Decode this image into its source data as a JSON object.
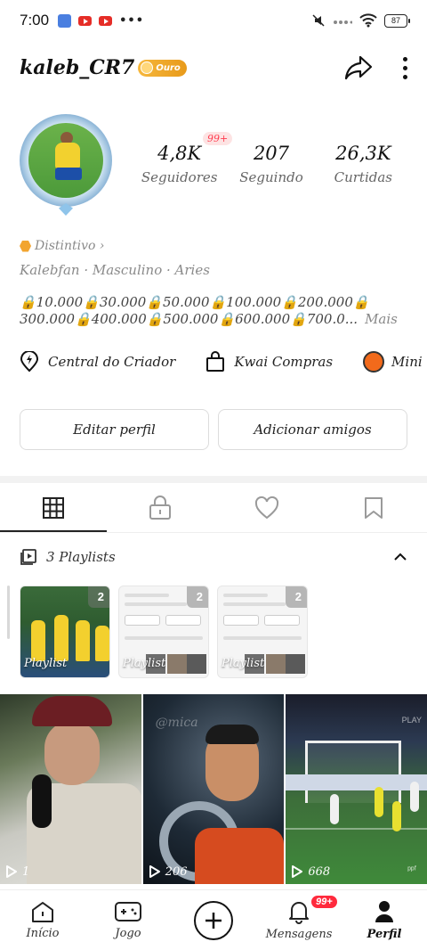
{
  "status_bar": {
    "time": "7:00",
    "notif_dots": "•••",
    "battery": "87"
  },
  "profile": {
    "username": "kaleb_CR7",
    "tier_badge": "Ouro",
    "stats": [
      {
        "value": "4,8K",
        "label": "Seguidores"
      },
      {
        "value": "207",
        "label": "Seguindo"
      },
      {
        "value": "26,3K",
        "label": "Curtidas"
      }
    ],
    "followers_notification": "99+",
    "distintivo": "Distintivo ›",
    "info_line": "Kalebfan · Masculino · Aries",
    "bio_line1": "🔒10.000🔒30.000🔒50.000🔒100.000🔒200.000🔒",
    "bio_line2": "300.000🔒400.000🔒500.000🔒600.000🔒700.0...",
    "bio_more": "Mais"
  },
  "shortcuts": [
    {
      "label": "Central do Criador",
      "icon": "lightning-pin-icon"
    },
    {
      "label": "Kwai Compras",
      "icon": "shopping-bag-icon"
    },
    {
      "label": "Mini",
      "icon": "mini-app-icon"
    }
  ],
  "actions": {
    "edit_profile": "Editar perfil",
    "add_friends": "Adicionar amigos"
  },
  "tabs": [
    {
      "name": "grid-icon",
      "active": true
    },
    {
      "name": "lock-icon",
      "active": false
    },
    {
      "name": "heart-icon",
      "active": false
    },
    {
      "name": "bookmark-icon",
      "active": false
    }
  ],
  "playlists": {
    "header": "3 Playlists",
    "items": [
      {
        "label": "Playlist",
        "count": "2"
      },
      {
        "label": "Playlist",
        "count": "2"
      },
      {
        "label": "Playlist",
        "count": "2"
      }
    ]
  },
  "videos": [
    {
      "plays": "1"
    },
    {
      "plays": "206"
    },
    {
      "plays": "668"
    }
  ],
  "video_overlays": {
    "v2_watermark": "@mica",
    "v3_watermark": "PLAY",
    "v3_logo": "ᵖᵖᶠ"
  },
  "bottom_nav": {
    "items": [
      {
        "label": "Início",
        "icon": "home-icon"
      },
      {
        "label": "Jogo",
        "icon": "gamepad-icon"
      },
      {
        "label": "",
        "icon": "plus-icon"
      },
      {
        "label": "Mensagens",
        "icon": "bell-icon",
        "badge": "99+"
      },
      {
        "label": "Perfil",
        "icon": "person-icon",
        "active": true
      }
    ]
  },
  "colors": {
    "accent_badge": "#ff2a3d",
    "gold_badge": "#f6b73c"
  }
}
